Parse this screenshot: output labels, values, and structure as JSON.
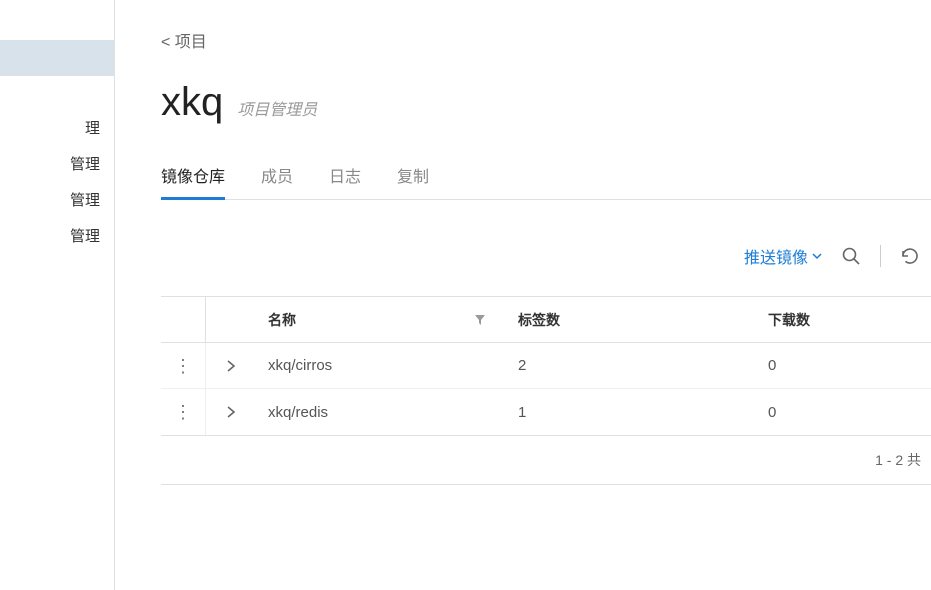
{
  "sidebar": {
    "items": [
      {
        "label": "",
        "active": true
      },
      {
        "label": "理"
      },
      {
        "label": "管理"
      },
      {
        "label": "管理"
      },
      {
        "label": "管理"
      }
    ]
  },
  "breadcrumb": {
    "back_label": "< 项目"
  },
  "header": {
    "title": "xkq",
    "role": "项目管理员"
  },
  "tabs": {
    "items": [
      {
        "label": "镜像仓库"
      },
      {
        "label": "成员"
      },
      {
        "label": "日志"
      },
      {
        "label": "复制"
      }
    ]
  },
  "toolbar": {
    "push_label": "推送镜像"
  },
  "table": {
    "columns": {
      "name": "名称",
      "tags": "标签数",
      "downloads": "下载数"
    },
    "rows": [
      {
        "name": "xkq/cirros",
        "tags": "2",
        "downloads": "0"
      },
      {
        "name": "xkq/redis",
        "tags": "1",
        "downloads": "0"
      }
    ],
    "pagination": "1 - 2 共"
  }
}
